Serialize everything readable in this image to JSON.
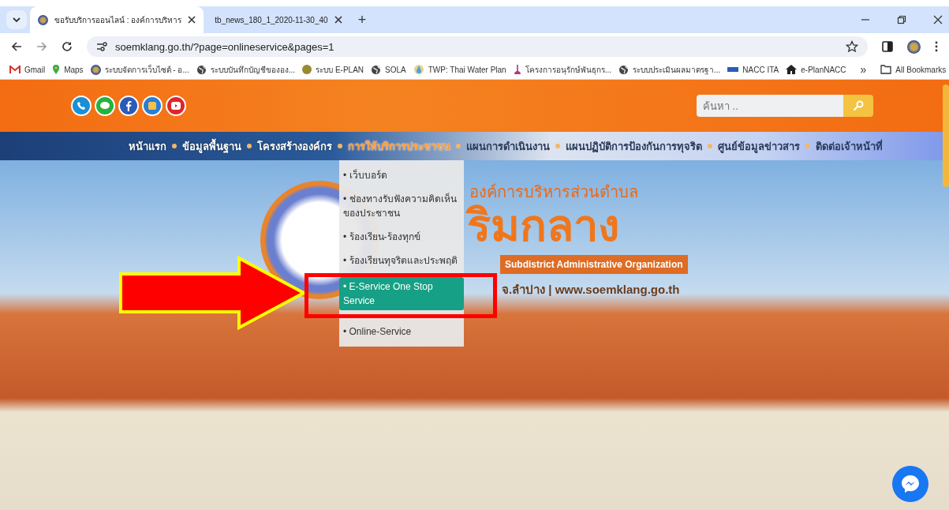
{
  "browser": {
    "tabs": [
      {
        "title": "ขอรับบริการออนไลน์ : องค์การบริหาร",
        "selected": true
      },
      {
        "title": "tb_news_180_1_2020-11-30_40",
        "selected": false
      }
    ],
    "new_tab": "+",
    "address": "soemklang.go.th/?page=onlineservice&pages=1",
    "bookmarks": [
      {
        "label": "Gmail",
        "kind": "gmail"
      },
      {
        "label": "Maps",
        "kind": "maps"
      },
      {
        "label": "ระบบจัดการเว็บไซต์ - อ...",
        "kind": "seal"
      },
      {
        "label": "ระบบบันทึกบัญชีขององ...",
        "kind": "globe"
      },
      {
        "label": "ระบบ E-PLAN",
        "kind": "coin"
      },
      {
        "label": "SOLA",
        "kind": "globe"
      },
      {
        "label": "TWP: Thai Water Plan",
        "kind": "drop"
      },
      {
        "label": "โครงการอนุรักษ์พันธุกร...",
        "kind": "plant"
      },
      {
        "label": "ระบบประเมินผลมาตรฐา...",
        "kind": "globe"
      },
      {
        "label": "NACC ITA",
        "kind": "ita"
      },
      {
        "label": "e-PlanNACC",
        "kind": "home"
      }
    ],
    "more_bookmarks": "»",
    "all_bookmarks": "All Bookmarks"
  },
  "site": {
    "search": {
      "placeholder": "ค้นหา .."
    },
    "nav": [
      {
        "label": "หน้าแรก",
        "selected": false
      },
      {
        "label": "ข้อมูลพื้นฐาน",
        "selected": false
      },
      {
        "label": "โครงสร้างองค์กร",
        "selected": false
      },
      {
        "label": "การให้บริการประชาชน",
        "selected": true
      },
      {
        "label": "แผนการดำเนินงาน",
        "selected": false
      },
      {
        "label": "แผนปฏิบัติการป้องกันการทุจริต",
        "selected": false
      },
      {
        "label": "ศูนย์ข้อมูลข่าวสาร",
        "selected": false
      },
      {
        "label": "ติดต่อเจ้าหน้าที่",
        "selected": false
      }
    ],
    "dropdown": [
      {
        "label": "• เว็บบอร์ด",
        "selected": false
      },
      {
        "label": "• ช่องทางรับฟังความคิดเห็นของประชาชน",
        "selected": false
      },
      {
        "label": "• ร้องเรียน-ร้องทุกข์",
        "selected": false
      },
      {
        "label": "• ร้องเรียนทุจริตและประพฤติ",
        "selected": false
      },
      {
        "label": "• E-Service One Stop Service",
        "selected": true
      },
      {
        "label": "• Online-Service",
        "selected": false
      }
    ],
    "banner": {
      "org_type": "องค์การบริหารส่วนตำบล",
      "name": "ริมกลาง",
      "english": "Subdistrict Administrative Organization",
      "address": "จ.ลำปาง | www.soemklang.go.th"
    }
  }
}
